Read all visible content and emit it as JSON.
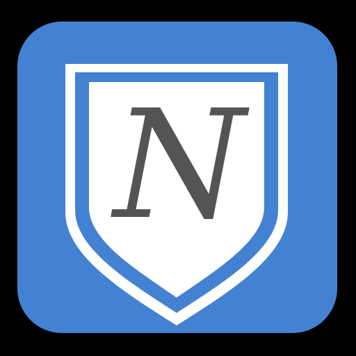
{
  "app_icon": {
    "logo_letter": "N"
  },
  "colors": {
    "background": "#000000",
    "tile": "#4382d2",
    "shield_outer": "#ffffff",
    "shield_band": "#4382d2",
    "shield_inner": "#ffffff",
    "letter": "#545454"
  },
  "icons": {
    "app_icon": "shield-n-app-icon",
    "shield": "shield-icon"
  }
}
